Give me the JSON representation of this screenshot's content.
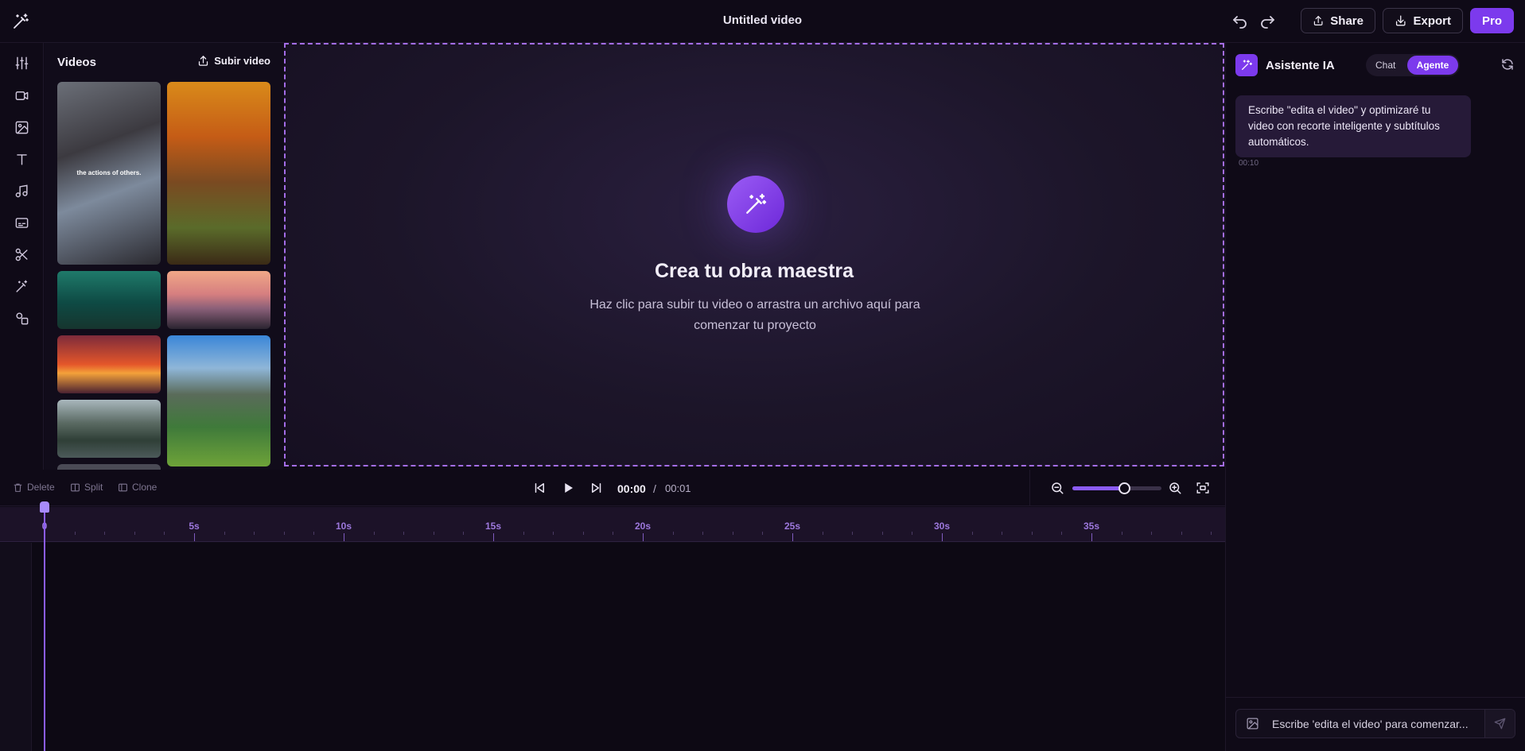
{
  "header": {
    "doc_title": "Untitled video",
    "share_label": "Share",
    "export_label": "Export",
    "pro_label": "Pro"
  },
  "media": {
    "title": "Videos",
    "upload_label": "Subir video",
    "thumb_caption": "the actions of others."
  },
  "canvas": {
    "title": "Crea tu obra maestra",
    "subtitle": "Haz clic para subir tu video o arrastra un archivo aquí para comenzar tu proyecto"
  },
  "playback": {
    "delete_label": "Delete",
    "split_label": "Split",
    "clone_label": "Clone",
    "current_time": "00:00",
    "separator": "/",
    "total_time": "00:01",
    "zoom_level": 0.58
  },
  "timeline": {
    "ticks": [
      "0",
      "5s",
      "10s",
      "15s",
      "20s",
      "25s",
      "30s",
      "35s"
    ]
  },
  "assistant": {
    "title": "Asistente IA",
    "tab_chat": "Chat",
    "tab_agent": "Agente",
    "message": "Escribe \"edita el video\" y optimizaré tu video con recorte inteligente y subtítulos automáticos.",
    "message_time": "00:10",
    "input_placeholder": "Escribe 'edita el video' para comenzar..."
  },
  "colors": {
    "accent": "#7c3aed",
    "background": "#0f0a17",
    "canvas_border": "#a46de8"
  }
}
